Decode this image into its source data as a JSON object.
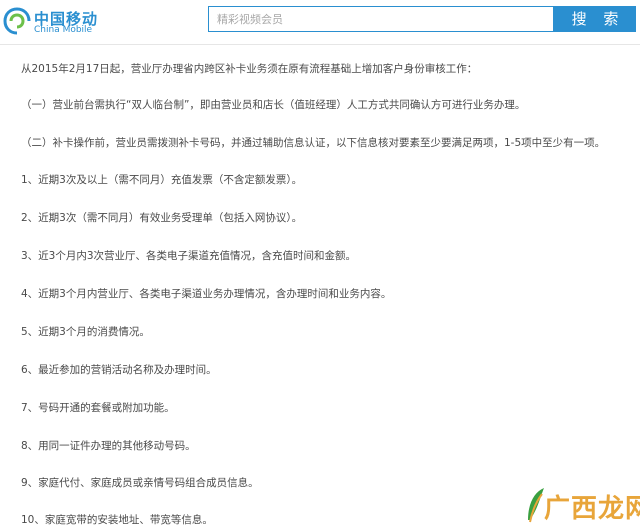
{
  "header": {
    "logo_cn": "中国移动",
    "logo_en": "China Mobile",
    "search_placeholder": "精彩视频会员",
    "search_button": "搜 索"
  },
  "paragraphs": [
    "从2015年2月17日起，营业厅办理省内跨区补卡业务须在原有流程基础上增加客户身份审核工作：",
    "（一）营业前台需执行“双人临台制”，即由营业员和店长（值班经理）人工方式共同确认方可进行业务办理。",
    "（二）补卡操作前，营业员需拨测补卡号码，并通过辅助信息认证，以下信息核对要素至少要满足两项，1-5项中至少有一项。",
    "1、近期3次及以上（需不同月）充值发票（不含定额发票）。",
    "2、近期3次（需不同月）有效业务受理单（包括入网协议）。",
    "3、近3个月内3次营业厅、各类电子渠道充值情况，含充值时间和金额。",
    "4、近期3个月内营业厅、各类电子渠道业务办理情况，含办理时间和业务内容。",
    "5、近期3个月的消费情况。",
    "6、最近参加的营销活动名称及办理时间。",
    "7、号码开通的套餐或附加功能。",
    "8、用同一证件办理的其他移动号码。",
    "9、家庭代付、家庭成员或亲情号码组合成员信息。",
    "10、家庭宽带的安装地址、带宽等信息。"
  ],
  "watermark": "广西龙网",
  "colors": {
    "brand_blue": "#2a8fd0",
    "text": "#4a4a4a",
    "watermark_orange": "#e8a53a",
    "watermark_green": "#3aa040"
  }
}
